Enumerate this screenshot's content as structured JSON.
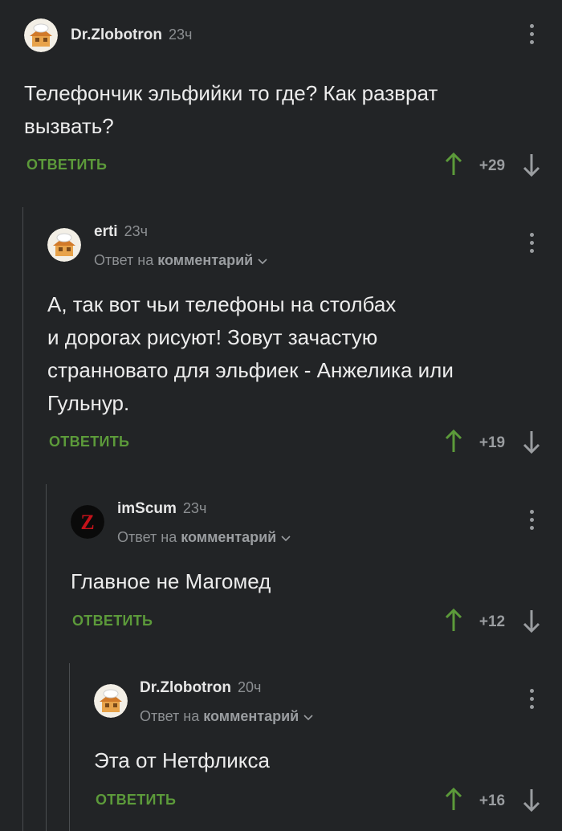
{
  "comments": [
    {
      "author": "Dr.Zlobotron",
      "time": "23ч",
      "reply_prefix": "",
      "reply_target": "",
      "text_lines": [
        "Телефончик эльфийки то где? Как разврат",
        "вызвать?"
      ],
      "reply_label": "ОТВЕТИТЬ",
      "score": "+29",
      "avatar_icon": "chef-house-avatar"
    },
    {
      "author": "erti",
      "time": "23ч",
      "reply_prefix": "Ответ на",
      "reply_target": "комментарий",
      "text_lines": [
        "А, так вот чьи телефоны на столбах",
        "и дорогах рисуют! Зовут зачастую",
        "странновато для эльфиек - Анжелика или",
        "Гульнур."
      ],
      "reply_label": "ОТВЕТИТЬ",
      "score": "+19",
      "avatar_icon": "chef-house-avatar"
    },
    {
      "author": "imScum",
      "time": "23ч",
      "reply_prefix": "Ответ на",
      "reply_target": "комментарий",
      "text_lines": [
        "Главное не Магомед"
      ],
      "reply_label": "ОТВЕТИТЬ",
      "score": "+12",
      "avatar_icon": "z-letter-avatar"
    },
    {
      "author": "Dr.Zlobotron",
      "time": "20ч",
      "reply_prefix": "Ответ на",
      "reply_target": "комментарий",
      "text_lines": [
        "Эта от Нетфликса"
      ],
      "reply_label": "ОТВЕТИТЬ",
      "score": "+16",
      "avatar_icon": "chef-house-avatar"
    }
  ],
  "colors": {
    "background": "#222426",
    "accent_green": "#5c9a3a",
    "muted": "#8c8f92"
  }
}
